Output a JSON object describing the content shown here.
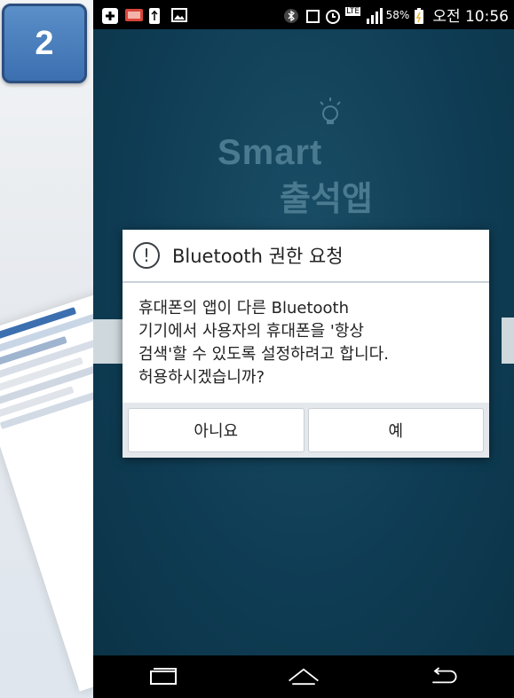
{
  "badge": {
    "number": "2"
  },
  "status_bar": {
    "battery_percent": "58%",
    "time": "오전 10:56",
    "network": "LTE",
    "icons": [
      "add-icon",
      "photo-badge-icon",
      "usb-icon",
      "image-icon",
      "bluetooth-icon",
      "screen-icon",
      "alarm-icon",
      "lte-icon",
      "signal-icon",
      "battery-icon"
    ]
  },
  "app": {
    "logo_text": "Smart",
    "logo_subtitle": "출석앱"
  },
  "dialog": {
    "title": "Bluetooth 권한 요청",
    "message_lines": [
      "휴대폰의 앱이 다른 Bluetooth",
      "기기에서 사용자의 휴대폰을 '항상",
      "검색'할 수 있도록 설정하려고 합니다.",
      "허용하시겠습니까?"
    ],
    "no_label": "아니요",
    "yes_label": "예"
  },
  "navbar": {
    "icons": [
      "recent-apps-icon",
      "home-icon",
      "back-icon"
    ]
  },
  "colors": {
    "app_background": "#0d3b51",
    "badge": "#4a7fbf",
    "dialog_header_divider": "#c9d1d8"
  }
}
